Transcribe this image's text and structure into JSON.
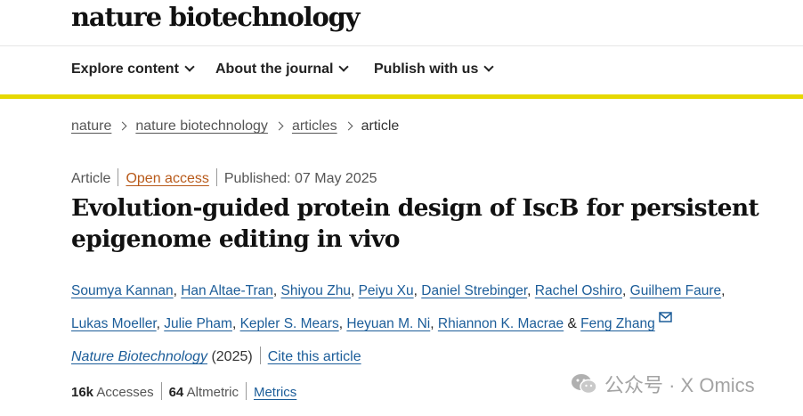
{
  "site": {
    "logo_text": "nature biotechnology"
  },
  "nav": {
    "items": [
      {
        "label": "Explore content"
      },
      {
        "label": "About the journal"
      },
      {
        "label": "Publish with us"
      }
    ],
    "accent_color": "#e6d800"
  },
  "breadcrumb": {
    "items": [
      "nature",
      "nature biotechnology",
      "articles"
    ],
    "current": "article"
  },
  "article_meta": {
    "type": "Article",
    "access": "Open access",
    "published": "Published: 07 May 2025"
  },
  "title": "Evolution-guided protein design of IscB for persistent epigenome editing in vivo",
  "authors": [
    "Soumya Kannan",
    "Han Altae-Tran",
    "Shiyou Zhu",
    "Peiyu Xu",
    "Daniel Strebinger",
    "Rachel Oshiro",
    "Guilhem Faure",
    "Lukas Moeller",
    "Julie Pham",
    "Kepler S. Mears",
    "Heyuan M. Ni",
    "Rhiannon K. Macrae",
    "Feng Zhang"
  ],
  "authors_conjunction": "&",
  "citation": {
    "journal": "Nature Biotechnology",
    "year": "(2025)",
    "cite_label": "Cite this article"
  },
  "metrics": {
    "accesses_value": "16k",
    "accesses_label": "Accesses",
    "altmetric_value": "64",
    "altmetric_label": "Altmetric",
    "metrics_link": "Metrics"
  },
  "watermark": {
    "text": "公众号 · X Omics"
  },
  "colors": {
    "link": "#1c5d99",
    "open_access": "#b85a1a"
  }
}
